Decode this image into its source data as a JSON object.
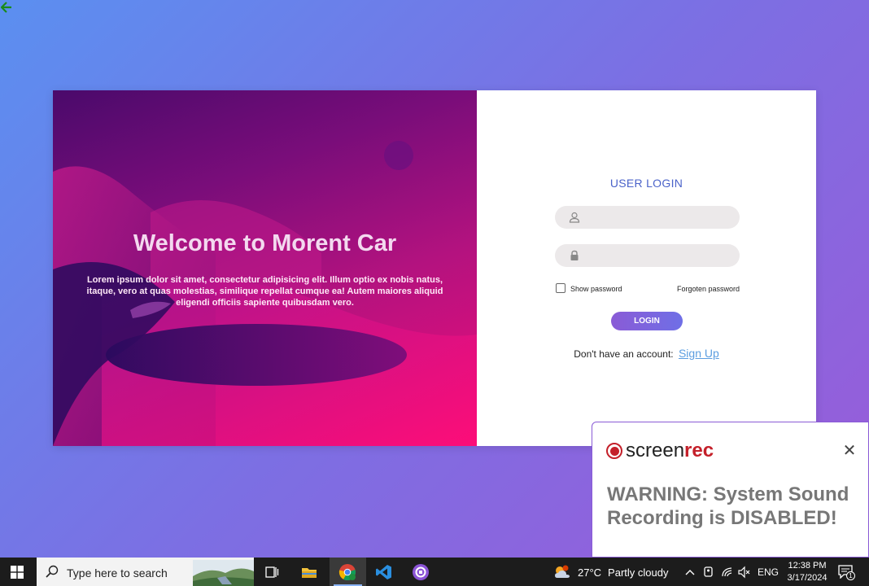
{
  "hero": {
    "title": "Welcome to Morent Car",
    "text": "Lorem ipsum dolor sit amet, consectetur adipisicing elit. Illum optio ex nobis natus, itaque, vero at quas molestias, similique repellat cumque ea! Autem maiores aliquid eligendi officiis sapiente quibusdam vero."
  },
  "login": {
    "title": "USER LOGIN",
    "username_placeholder": "",
    "password_placeholder": "",
    "show_password_label": "Show password",
    "forgot_label": "Forgoten password",
    "button_label": "LOGIN",
    "no_account_text": "Don't have an account:",
    "signup_label": "Sign Up"
  },
  "popup": {
    "brand_part1": "screen",
    "brand_part2": "rec",
    "warning": "WARNING: System Sound Recording is DISABLED!",
    "close_symbol": "✕"
  },
  "taskbar": {
    "search_placeholder": "Type here to search",
    "weather_temp": "27°C",
    "weather_desc": "Partly cloudy",
    "language": "ENG",
    "time": "12:38 PM",
    "date": "3/17/2024",
    "notification_count": "1"
  },
  "colors": {
    "accent": "#4b63c9",
    "link": "#5b9de0",
    "brand_red": "#c4202a"
  }
}
